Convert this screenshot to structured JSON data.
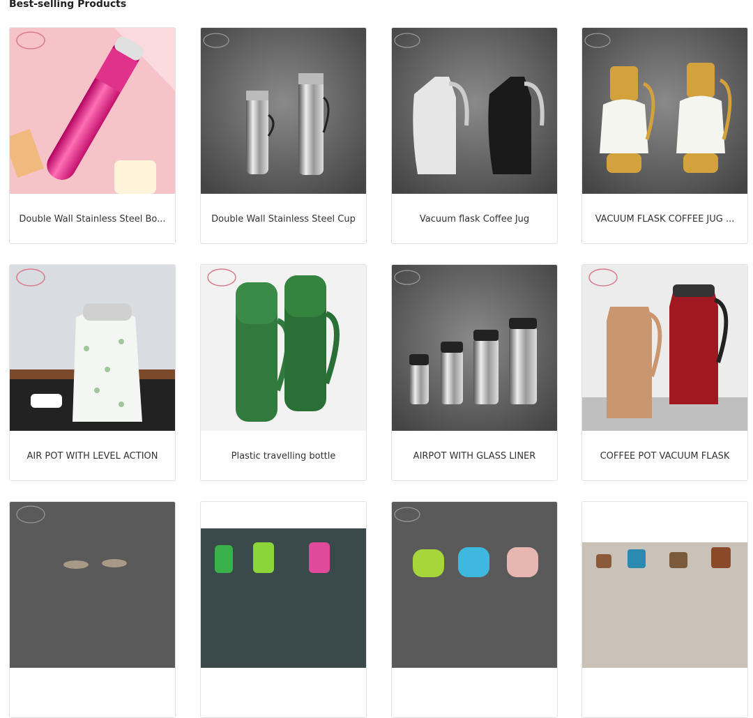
{
  "section": {
    "title": "Best-selling Products"
  },
  "products": [
    {
      "name": "Double Wall Stainless Steel Bo..."
    },
    {
      "name": "Double Wall Stainless Steel Cup"
    },
    {
      "name": "Vacuum flask Coffee Jug"
    },
    {
      "name": "VACUUM FLASK COFFEE JUG ..."
    },
    {
      "name": "AIR POT WITH LEVEL ACTION"
    },
    {
      "name": "Plastic travelling bottle"
    },
    {
      "name": "AIRPOT WITH GLASS LINER"
    },
    {
      "name": "COFFEE POT VACUUM FLASK"
    }
  ],
  "colors": {
    "card_border": "#e2e2e2",
    "text": "#333333",
    "title": "#222222",
    "dark_bg": "#555555"
  }
}
